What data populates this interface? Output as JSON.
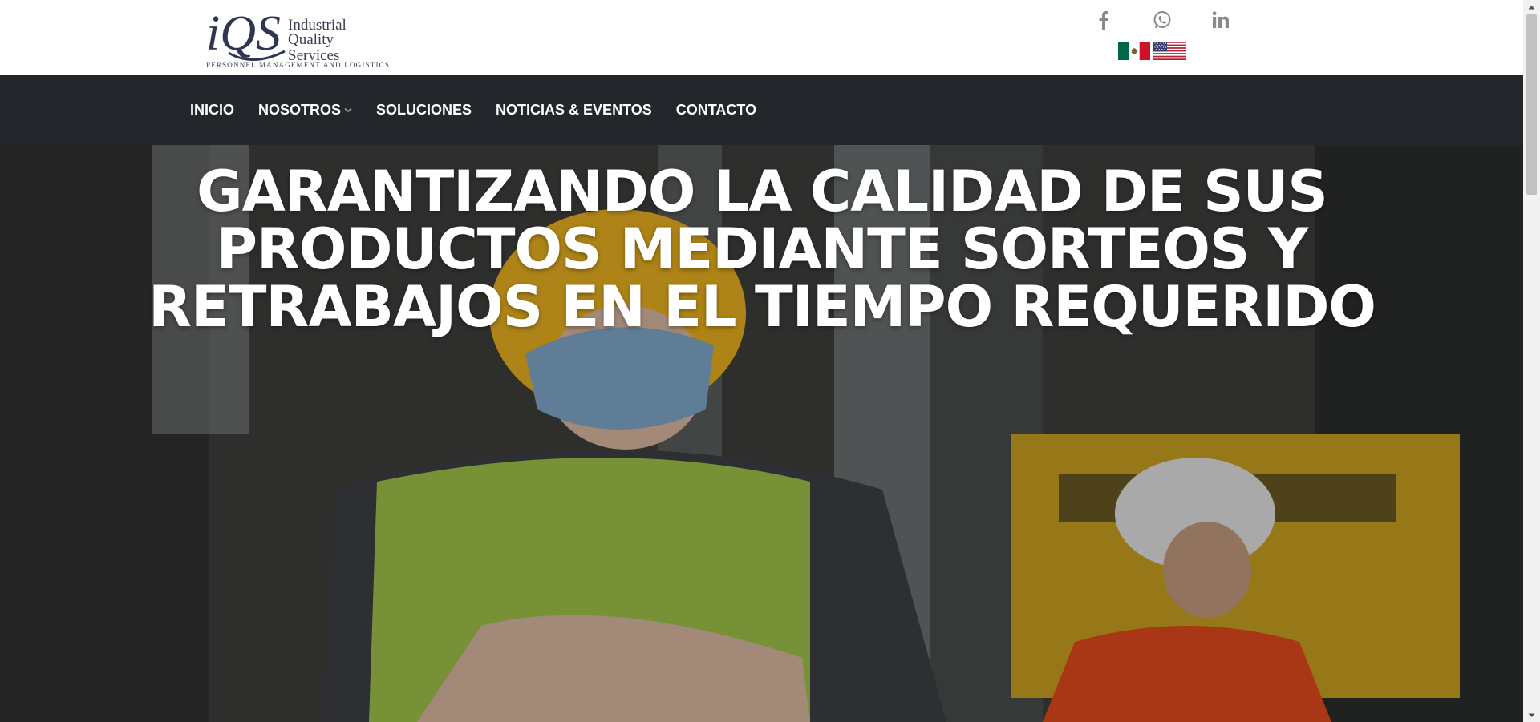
{
  "logo": {
    "mark_text": "iQS",
    "name_line1": "Industrial",
    "name_line2": "Quality Services",
    "tagline": "PERSONNEL MANAGEMENT AND LOGISTICS"
  },
  "social": {
    "icons": [
      "facebook-icon",
      "whatsapp-icon",
      "linkedin-icon"
    ],
    "icon_color": "#8a8a8a"
  },
  "languages": {
    "flags": [
      "mexico-flag",
      "usa-flag"
    ]
  },
  "nav": {
    "items": [
      {
        "label": "INICIO"
      },
      {
        "label": "NOSOTROS",
        "has_dropdown": true
      },
      {
        "label": "SOLUCIONES"
      },
      {
        "label": "NOTICIAS & EVENTOS"
      },
      {
        "label": "CONTACTO"
      }
    ],
    "background": "#23272b",
    "text_color": "#ffffff"
  },
  "hero": {
    "headline_line1": "GARANTIZANDO LA CALIDAD DE SUS",
    "headline_line2": "PRODUCTOS MEDIANTE SORTEOS Y",
    "headline_line3": "RETRABAJOS EN EL TIEMPO REQUERIDO"
  }
}
